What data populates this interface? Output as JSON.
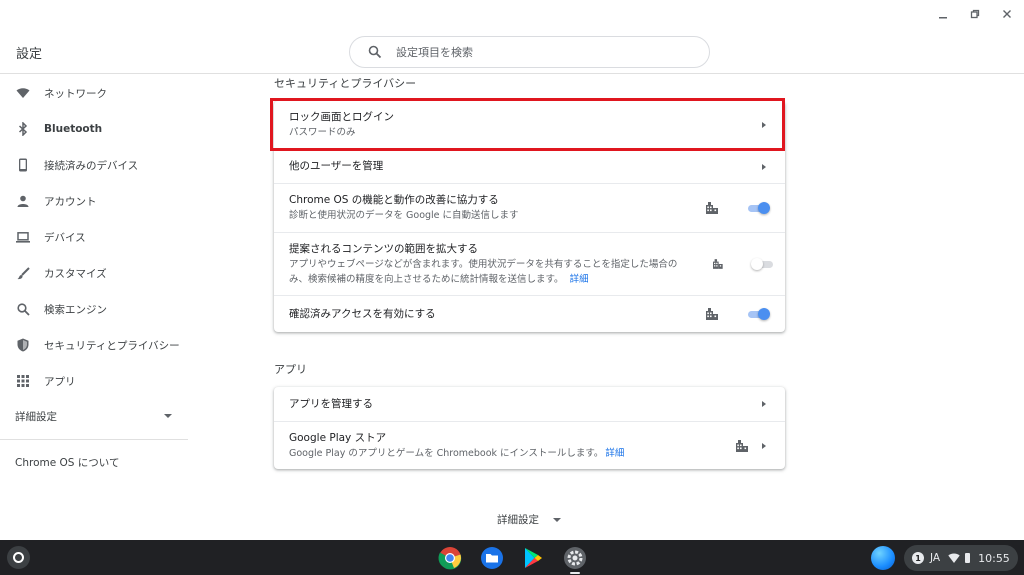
{
  "window": {
    "title": "設定"
  },
  "search": {
    "placeholder": "設定項目を検索"
  },
  "sidebar": {
    "items": [
      {
        "label": "ネットワーク",
        "icon": "wifi-icon"
      },
      {
        "label": "Bluetooth",
        "icon": "bluetooth-icon"
      },
      {
        "label": "接続済みのデバイス",
        "icon": "phone-icon"
      },
      {
        "label": "アカウント",
        "icon": "person-icon"
      },
      {
        "label": "デバイス",
        "icon": "laptop-icon"
      },
      {
        "label": "カスタマイズ",
        "icon": "brush-icon"
      },
      {
        "label": "検索エンジン",
        "icon": "search-icon"
      },
      {
        "label": "セキュリティとプライバシー",
        "icon": "shield-icon"
      },
      {
        "label": "アプリ",
        "icon": "apps-grid-icon"
      }
    ],
    "advanced": "詳細設定",
    "about": "Chrome OS について"
  },
  "security": {
    "title": "セキュリティとプライバシー",
    "rows": [
      {
        "title": "ロック画面とログイン",
        "subtitle": "パスワードのみ"
      },
      {
        "title": "他のユーザーを管理"
      },
      {
        "title": "Chrome OS の機能と動作の改善に協力する",
        "subtitle": "診断と使用状況のデータを Google に自動送信します",
        "toggle": true
      },
      {
        "title": "提案されるコンテンツの範囲を拡大する",
        "subtitle": "アプリやウェブページなどが含まれます。使用状況データを共有することを指定した場合のみ、検索候補の精度を向上させるために統計情報を送信します。",
        "link": "詳細",
        "toggle": false
      },
      {
        "title": "確認済みアクセスを有効にする",
        "toggle": true
      }
    ]
  },
  "apps": {
    "title": "アプリ",
    "rows": [
      {
        "title": "アプリを管理する"
      },
      {
        "title": "Google Play ストア",
        "subtitle": "Google Play のアプリとゲームを Chromebook にインストールします。",
        "link": "詳細"
      }
    ]
  },
  "footer": {
    "advanced": "詳細設定"
  },
  "shelf": {
    "apps": [
      "chrome-icon",
      "files-icon",
      "play-store-icon",
      "settings-icon"
    ],
    "tray": {
      "notifications": "1",
      "ime": "JA",
      "time": "10:55"
    }
  },
  "colors": {
    "accent": "#1a73e8",
    "highlight": "#e0161f",
    "shelf": "#202124"
  }
}
